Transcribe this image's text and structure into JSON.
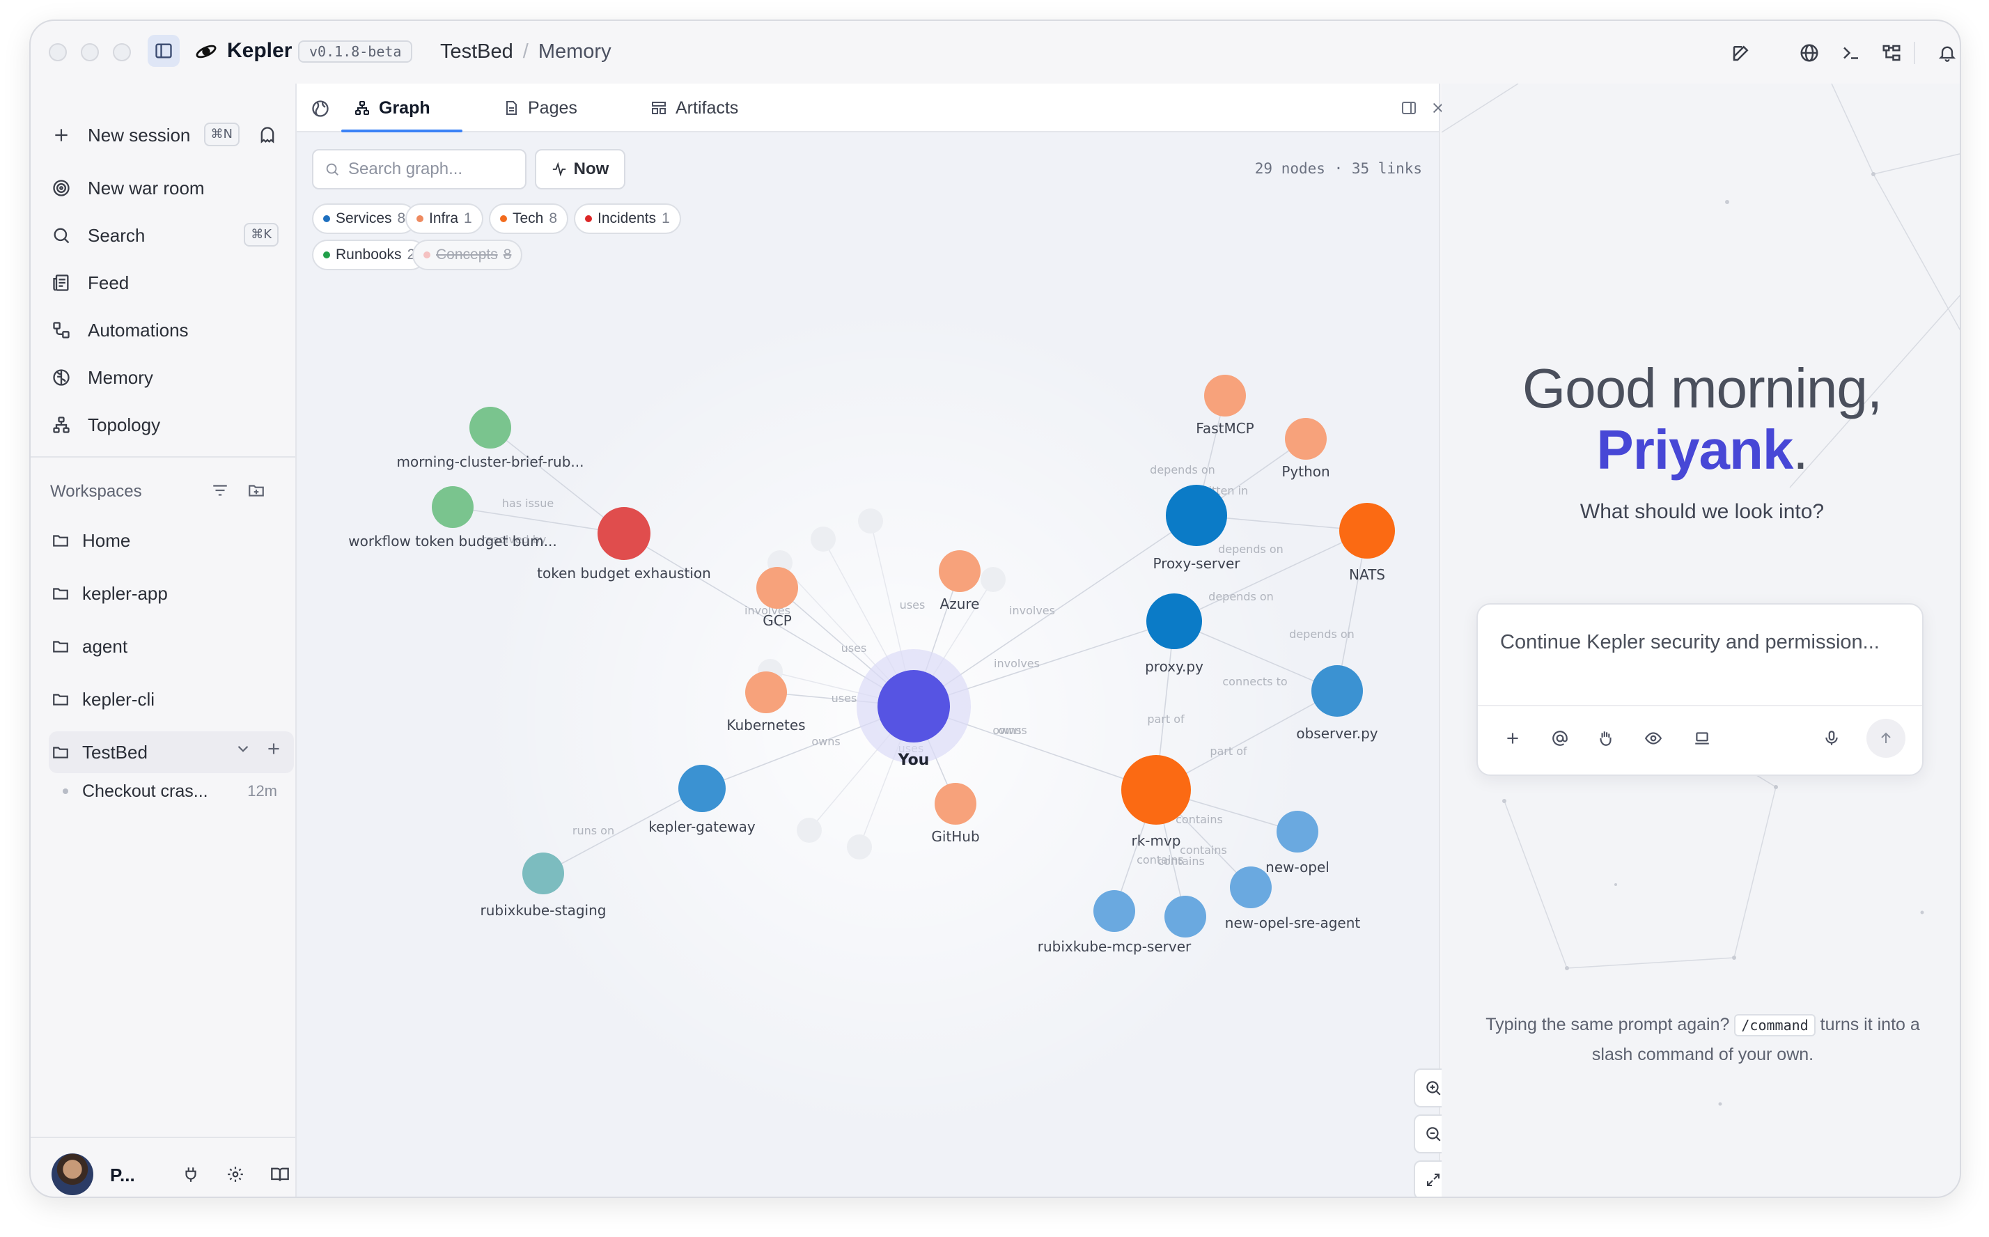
{
  "app": {
    "name": "Kepler",
    "version": "v0.1.8-beta",
    "breadcrumb": [
      "TestBed",
      "Memory"
    ]
  },
  "sidebar": {
    "new_session": {
      "label": "New session",
      "shortcut": "⌘N"
    },
    "items": [
      {
        "label": "New war room",
        "icon": "radar-icon"
      },
      {
        "label": "Search",
        "icon": "search-icon",
        "shortcut": "⌘K"
      },
      {
        "label": "Feed",
        "icon": "newspaper-icon"
      },
      {
        "label": "Automations",
        "icon": "workflow-icon"
      },
      {
        "label": "Memory",
        "icon": "brain-icon"
      },
      {
        "label": "Topology",
        "icon": "network-icon"
      }
    ],
    "workspaces_heading": "Workspaces",
    "workspaces": [
      "Home",
      "kepler-app",
      "agent",
      "kepler-cli",
      "TestBed"
    ],
    "session": {
      "title": "Checkout cras...",
      "time": "12m"
    },
    "user": {
      "name": "P..."
    }
  },
  "panel": {
    "tabs": [
      "Graph",
      "Pages",
      "Artifacts"
    ],
    "active_tab": "Graph",
    "search_placeholder": "Search graph...",
    "now_label": "Now",
    "stats": "29 nodes · 35 links",
    "filters": [
      {
        "label": "Services",
        "count": "8",
        "color": "#1d6fbf"
      },
      {
        "label": "Infra",
        "count": "1",
        "color": "#ee8a5f"
      },
      {
        "label": "Tech",
        "count": "8",
        "color": "#f26b1d"
      },
      {
        "label": "Incidents",
        "count": "1",
        "color": "#dc2626"
      },
      {
        "label": "Runbooks",
        "count": "2",
        "color": "#22a04a"
      },
      {
        "label": "Concepts",
        "count": "8",
        "color": "#f5c2c2"
      }
    ]
  },
  "graph": {
    "nodes": [
      {
        "id": "you",
        "label": "You",
        "color": "#5654e3"
      },
      {
        "id": "fastmcp",
        "label": "FastMCP",
        "color": "#f7a27b"
      },
      {
        "id": "python",
        "label": "Python",
        "color": "#f7a27b"
      },
      {
        "id": "proxyserver",
        "label": "Proxy-server",
        "color": "#0b7bc7"
      },
      {
        "id": "nats",
        "label": "NATS",
        "color": "#fb6a13"
      },
      {
        "id": "proxypy",
        "label": "proxy.py",
        "color": "#0b7bc7"
      },
      {
        "id": "observer",
        "label": "observer.py",
        "color": "#3b92d2"
      },
      {
        "id": "rkmvp",
        "label": "rk-mvp",
        "color": "#fb6a13"
      },
      {
        "id": "newopel",
        "label": "new-opel",
        "color": "#6aa9e0"
      },
      {
        "id": "newopelsre",
        "label": "new-opel-sre-agent",
        "color": "#6aa9e0"
      },
      {
        "id": "rubixmcp",
        "label": "rubixkube-mcp-server",
        "color": "#6aa9e0"
      },
      {
        "id": "rubixmcp2",
        "label": "",
        "color": "#6aa9e0"
      },
      {
        "id": "azure",
        "label": "Azure",
        "color": "#f7a27b"
      },
      {
        "id": "gcp",
        "label": "GCP",
        "color": "#f7a27b"
      },
      {
        "id": "kubernetes",
        "label": "Kubernetes",
        "color": "#f7a27b"
      },
      {
        "id": "github",
        "label": "GitHub",
        "color": "#f7a27b"
      },
      {
        "id": "gateway",
        "label": "kepler-gateway",
        "color": "#3b92d2"
      },
      {
        "id": "staging",
        "label": "rubixkube-staging",
        "color": "#7cbcbf"
      },
      {
        "id": "tokenbudget",
        "label": "token budget exhaustion",
        "color": "#e04d4d"
      },
      {
        "id": "morning",
        "label": "morning-cluster-brief-rub...",
        "color": "#7ac48e"
      },
      {
        "id": "workflow",
        "label": "workflow token budget bum...",
        "color": "#7ac48e"
      }
    ],
    "edge_labels": [
      "depends on",
      "written in",
      "depends on",
      "depends on",
      "depends on",
      "connects to",
      "part of",
      "part of",
      "involves",
      "involves",
      "owns",
      "uses",
      "uses",
      "uses",
      "uses",
      "runs on",
      "has issue",
      "resolved by",
      "involves",
      "contains",
      "contains",
      "contains",
      "contains",
      "owns",
      "owns"
    ]
  },
  "chat": {
    "greeting_line1": "Good morning,",
    "greeting_name": "Priyank",
    "greeting_punct": ".",
    "question": "What should we look into?",
    "composer_text": "Continue Kepler security and permission...",
    "tip_before": "Typing the same prompt again?",
    "tip_code": "/command",
    "tip_after": "turns it into a slash command of your own."
  }
}
